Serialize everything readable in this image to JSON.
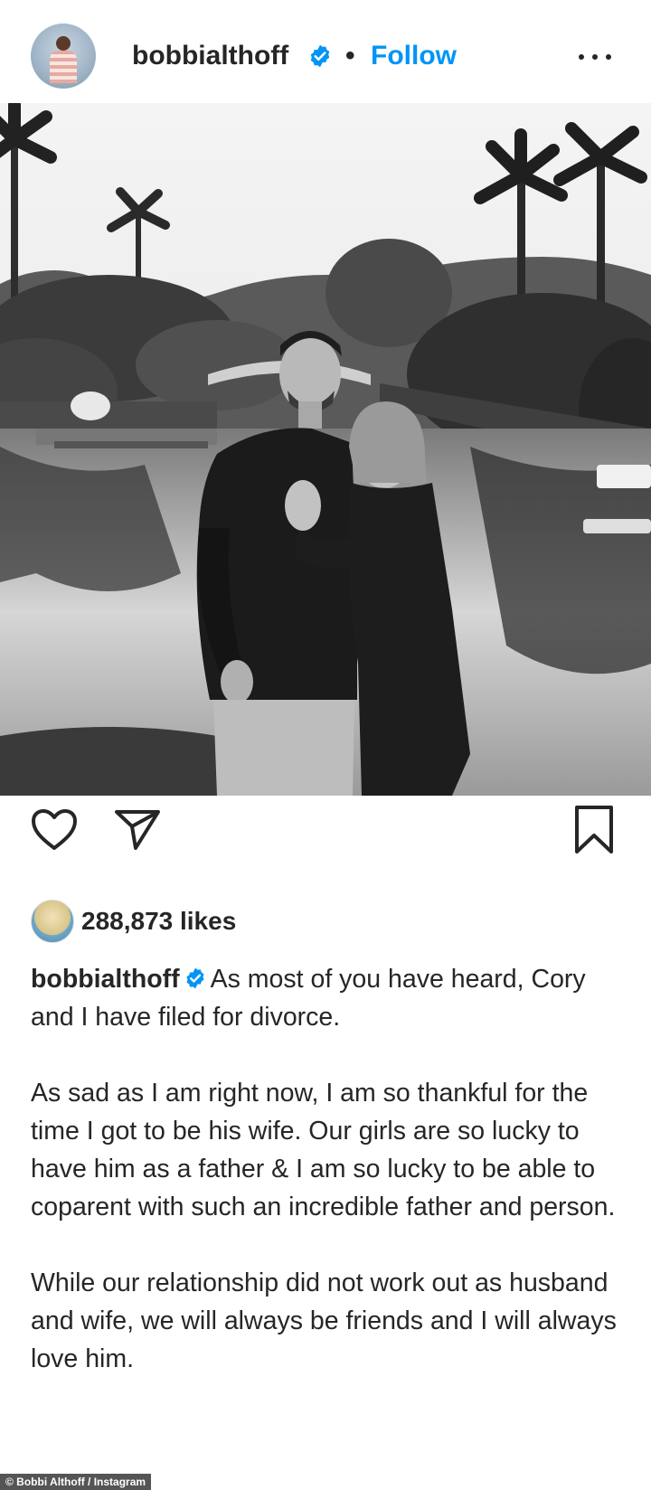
{
  "post": {
    "username": "bobbialthoff",
    "separator": "•",
    "follow_label": "Follow",
    "likes": "288,873 likes",
    "caption": {
      "username": "bobbialthoff",
      "paragraph_1": "As most of you have heard, Cory and I have filed for divorce.",
      "paragraph_2": "As sad as I am right now, I am so thankful for the time I got to be his wife. Our girls are so lucky to have him as a father & I am so lucky to be able to coparent with such an incredible father and person.",
      "paragraph_3": "While our relationship did not work out as husband and wife, we will always be friends and I will always love him."
    }
  },
  "icons": {
    "verified": "verified-badge-icon",
    "more": "more-options-icon",
    "like": "heart-icon",
    "share": "paper-plane-icon",
    "save": "bookmark-icon"
  },
  "colors": {
    "follow": "#0095f6",
    "verified": "#0095f6",
    "text": "#262626"
  },
  "credit": "© Bobbi Althoff / Instagram"
}
